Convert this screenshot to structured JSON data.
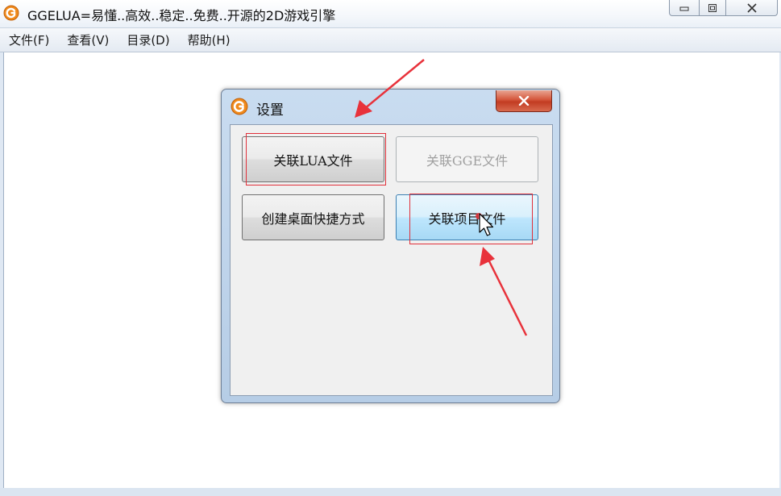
{
  "window": {
    "title": "GGELUA=易懂..高效..稳定..免费..开源的2D游戏引擎",
    "icon": "ggelua-logo-icon"
  },
  "menubar": {
    "items": [
      {
        "label": "文件(F)"
      },
      {
        "label": "查看(V)"
      },
      {
        "label": "目录(D)"
      },
      {
        "label": "帮助(H)"
      }
    ]
  },
  "dialog": {
    "title": "设置",
    "icon": "ggelua-logo-icon",
    "buttons": {
      "associate_lua": "关联LUA文件",
      "associate_gge": "关联GGE文件",
      "create_shortcut": "创建桌面快捷方式",
      "associate_project": "关联项目文件"
    }
  },
  "colors": {
    "annotation": "#e0303a",
    "dialog_close": "#c23c22",
    "hover_border": "#3c7fb1"
  }
}
